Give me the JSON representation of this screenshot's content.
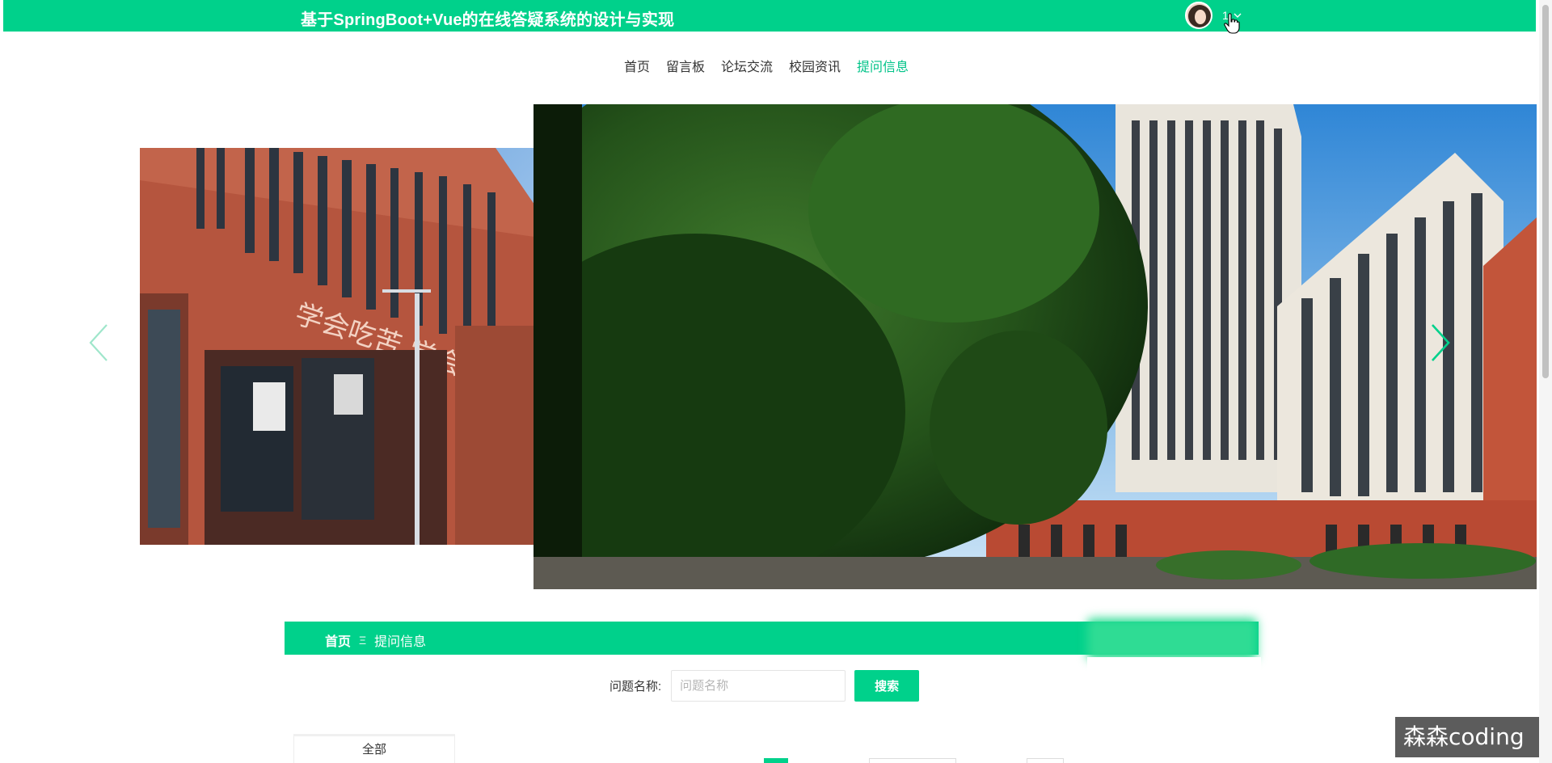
{
  "header": {
    "title": "基于SpringBoot+Vue的在线答疑系统的设计与实现",
    "user_name": "1"
  },
  "nav": {
    "items": [
      {
        "label": "首页"
      },
      {
        "label": "留言板"
      },
      {
        "label": "论坛交流"
      },
      {
        "label": "校园资讯"
      },
      {
        "label": "提问信息"
      }
    ],
    "active_index": 4
  },
  "carousel": {
    "slide_text": "学会吃苦  学会做人"
  },
  "breadcrumb": {
    "home": "首页",
    "separator": "Ξ",
    "current": "提问信息"
  },
  "search": {
    "label": "问题名称:",
    "placeholder": "问题名称",
    "value": "",
    "button_label": "搜索"
  },
  "category": {
    "tab_label": "全部"
  },
  "watermark": {
    "text": "森森coding"
  },
  "colors": {
    "brand": "#00d18b",
    "active_nav": "#00c388"
  },
  "icons": {
    "carousel_prev": "chevron-left-icon",
    "carousel_next": "chevron-right-icon",
    "user_menu": "chevron-down-icon",
    "cursor": "hand-pointer-icon"
  }
}
